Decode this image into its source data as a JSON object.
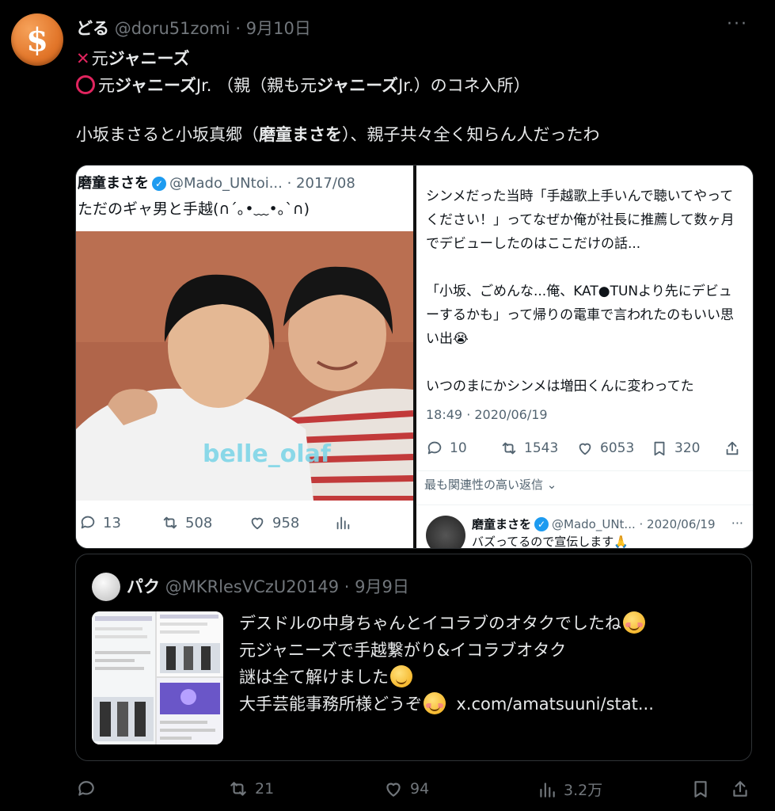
{
  "tweet": {
    "avatar_glyph": "$",
    "author_name": "どる",
    "author_handle": "@doru51zomi",
    "separator": "·",
    "date": "9月10日",
    "more_label": "···",
    "lines": [
      {
        "mark": "❌",
        "prefix": "元",
        "bold": "ジャニーズ",
        "rest": ""
      },
      {
        "mark": "⭕",
        "prefix": "元",
        "bold": "ジャニーズ",
        "rest": "Jr. （親（親も元",
        "bold2": "ジャニーズ",
        "rest2": "Jr.）のコネ入所）"
      }
    ],
    "body_pre": "小坂まさると小坂真郷（",
    "body_bold": "磨童まさを",
    "body_post": "）、親子共々全く知らん人だったわ",
    "stats": {
      "replies": "",
      "retweets": "21",
      "likes": "94",
      "views": "3.2万"
    }
  },
  "media_left": {
    "author_name": "磨童まさを",
    "author_handle": "@Mado_UNtoi...",
    "date": "· 2017/08",
    "text": "ただのギャ男と手越(∩´｡•﹏•｡`∩)",
    "watermark": "belle_olaf",
    "stats": {
      "replies": "13",
      "retweets": "508",
      "likes": "958"
    }
  },
  "media_right": {
    "paragraphs": [
      "シンメだった当時「手越歌上手いんで聴いてやってください！」ってなぜか俺が社長に推薦して数ヶ月でデビューしたのはここだけの話...",
      "「小坂、ごめんな...俺、KAT●TUNより先にデビューするかも」って帰りの電車で言われたのもいい思い出😭",
      "いつのまにかシンメは増田くんに変わってた"
    ],
    "timestamp": "18:49 · 2020/06/19",
    "stats": {
      "replies": "10",
      "retweets": "1543",
      "likes": "6053",
      "bookmarks": "320"
    },
    "relevance_label": "最も関連性の高い返信",
    "reply": {
      "author_name": "磨童まさを",
      "author_handle": "@Mado_UNt...",
      "date": "· 2020/06/19",
      "text": "バズってるので宣伝します🙏"
    }
  },
  "quote": {
    "author_name": "パク",
    "author_handle": "@MKRlesVCzU20149",
    "date": "· 9月9日",
    "line1": "デスドルの中身ちゃんとイコラブのオタクでしたね",
    "line2": "元ジャニーズで手越繋がり&イコラブオタク",
    "line3": "謎は全て解けました",
    "line4": "大手芸能事務所様どうぞ",
    "link": "x.com/amatsuuni/stat..."
  },
  "colors": {
    "background": "#000000",
    "text": "#e7e9ea",
    "muted": "#71767b",
    "accent": "#1d9bf0",
    "mark_red": "#e0245e"
  }
}
